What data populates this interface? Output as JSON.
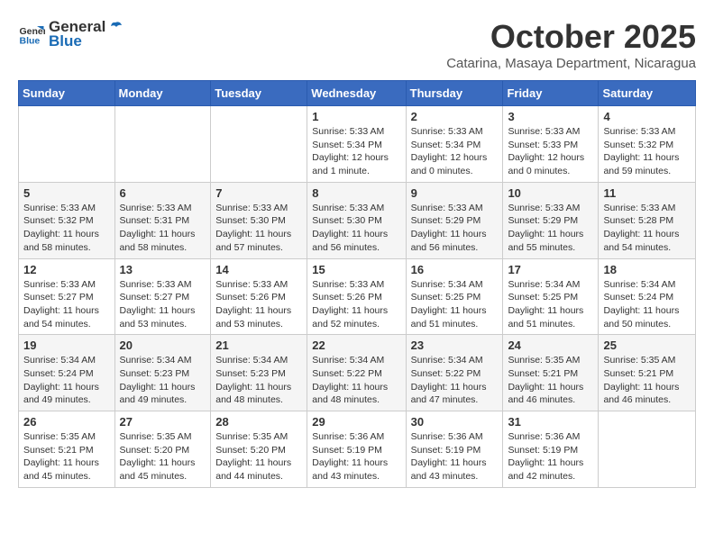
{
  "logo": {
    "general": "General",
    "blue": "Blue"
  },
  "header": {
    "month": "October 2025",
    "location": "Catarina, Masaya Department, Nicaragua"
  },
  "days_of_week": [
    "Sunday",
    "Monday",
    "Tuesday",
    "Wednesday",
    "Thursday",
    "Friday",
    "Saturday"
  ],
  "weeks": [
    [
      {
        "day": "",
        "info": ""
      },
      {
        "day": "",
        "info": ""
      },
      {
        "day": "",
        "info": ""
      },
      {
        "day": "1",
        "info": "Sunrise: 5:33 AM\nSunset: 5:34 PM\nDaylight: 12 hours and 1 minute."
      },
      {
        "day": "2",
        "info": "Sunrise: 5:33 AM\nSunset: 5:34 PM\nDaylight: 12 hours and 0 minutes."
      },
      {
        "day": "3",
        "info": "Sunrise: 5:33 AM\nSunset: 5:33 PM\nDaylight: 12 hours and 0 minutes."
      },
      {
        "day": "4",
        "info": "Sunrise: 5:33 AM\nSunset: 5:32 PM\nDaylight: 11 hours and 59 minutes."
      }
    ],
    [
      {
        "day": "5",
        "info": "Sunrise: 5:33 AM\nSunset: 5:32 PM\nDaylight: 11 hours and 58 minutes."
      },
      {
        "day": "6",
        "info": "Sunrise: 5:33 AM\nSunset: 5:31 PM\nDaylight: 11 hours and 58 minutes."
      },
      {
        "day": "7",
        "info": "Sunrise: 5:33 AM\nSunset: 5:30 PM\nDaylight: 11 hours and 57 minutes."
      },
      {
        "day": "8",
        "info": "Sunrise: 5:33 AM\nSunset: 5:30 PM\nDaylight: 11 hours and 56 minutes."
      },
      {
        "day": "9",
        "info": "Sunrise: 5:33 AM\nSunset: 5:29 PM\nDaylight: 11 hours and 56 minutes."
      },
      {
        "day": "10",
        "info": "Sunrise: 5:33 AM\nSunset: 5:29 PM\nDaylight: 11 hours and 55 minutes."
      },
      {
        "day": "11",
        "info": "Sunrise: 5:33 AM\nSunset: 5:28 PM\nDaylight: 11 hours and 54 minutes."
      }
    ],
    [
      {
        "day": "12",
        "info": "Sunrise: 5:33 AM\nSunset: 5:27 PM\nDaylight: 11 hours and 54 minutes."
      },
      {
        "day": "13",
        "info": "Sunrise: 5:33 AM\nSunset: 5:27 PM\nDaylight: 11 hours and 53 minutes."
      },
      {
        "day": "14",
        "info": "Sunrise: 5:33 AM\nSunset: 5:26 PM\nDaylight: 11 hours and 53 minutes."
      },
      {
        "day": "15",
        "info": "Sunrise: 5:33 AM\nSunset: 5:26 PM\nDaylight: 11 hours and 52 minutes."
      },
      {
        "day": "16",
        "info": "Sunrise: 5:34 AM\nSunset: 5:25 PM\nDaylight: 11 hours and 51 minutes."
      },
      {
        "day": "17",
        "info": "Sunrise: 5:34 AM\nSunset: 5:25 PM\nDaylight: 11 hours and 51 minutes."
      },
      {
        "day": "18",
        "info": "Sunrise: 5:34 AM\nSunset: 5:24 PM\nDaylight: 11 hours and 50 minutes."
      }
    ],
    [
      {
        "day": "19",
        "info": "Sunrise: 5:34 AM\nSunset: 5:24 PM\nDaylight: 11 hours and 49 minutes."
      },
      {
        "day": "20",
        "info": "Sunrise: 5:34 AM\nSunset: 5:23 PM\nDaylight: 11 hours and 49 minutes."
      },
      {
        "day": "21",
        "info": "Sunrise: 5:34 AM\nSunset: 5:23 PM\nDaylight: 11 hours and 48 minutes."
      },
      {
        "day": "22",
        "info": "Sunrise: 5:34 AM\nSunset: 5:22 PM\nDaylight: 11 hours and 48 minutes."
      },
      {
        "day": "23",
        "info": "Sunrise: 5:34 AM\nSunset: 5:22 PM\nDaylight: 11 hours and 47 minutes."
      },
      {
        "day": "24",
        "info": "Sunrise: 5:35 AM\nSunset: 5:21 PM\nDaylight: 11 hours and 46 minutes."
      },
      {
        "day": "25",
        "info": "Sunrise: 5:35 AM\nSunset: 5:21 PM\nDaylight: 11 hours and 46 minutes."
      }
    ],
    [
      {
        "day": "26",
        "info": "Sunrise: 5:35 AM\nSunset: 5:21 PM\nDaylight: 11 hours and 45 minutes."
      },
      {
        "day": "27",
        "info": "Sunrise: 5:35 AM\nSunset: 5:20 PM\nDaylight: 11 hours and 45 minutes."
      },
      {
        "day": "28",
        "info": "Sunrise: 5:35 AM\nSunset: 5:20 PM\nDaylight: 11 hours and 44 minutes."
      },
      {
        "day": "29",
        "info": "Sunrise: 5:36 AM\nSunset: 5:19 PM\nDaylight: 11 hours and 43 minutes."
      },
      {
        "day": "30",
        "info": "Sunrise: 5:36 AM\nSunset: 5:19 PM\nDaylight: 11 hours and 43 minutes."
      },
      {
        "day": "31",
        "info": "Sunrise: 5:36 AM\nSunset: 5:19 PM\nDaylight: 11 hours and 42 minutes."
      },
      {
        "day": "",
        "info": ""
      }
    ]
  ]
}
